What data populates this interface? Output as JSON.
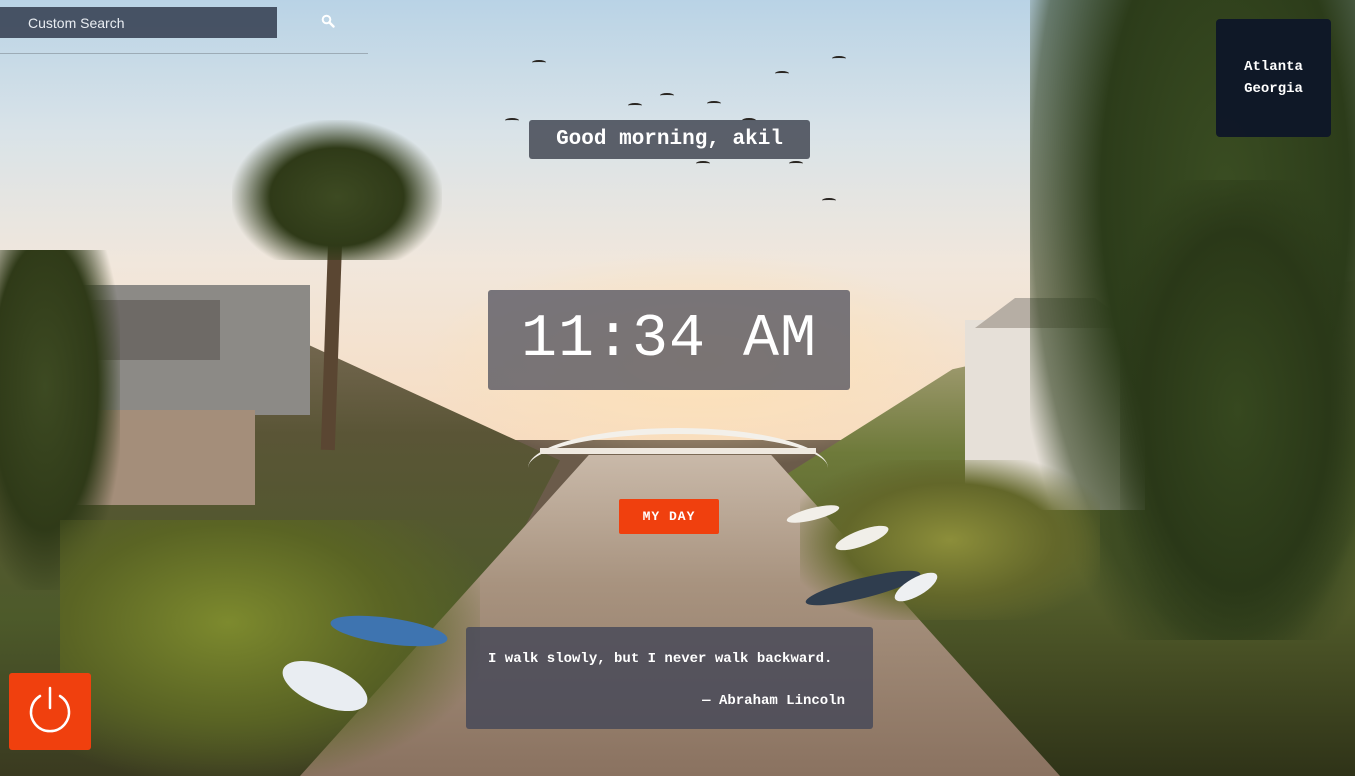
{
  "search": {
    "label": "Custom Search",
    "icon": "search-icon"
  },
  "location": {
    "city": "Atlanta",
    "region": "Georgia"
  },
  "greeting": {
    "text": "Good morning, akil"
  },
  "clock": {
    "time": "11:34 AM"
  },
  "my_day_button": {
    "label": "MY DAY",
    "color": "#f0400e"
  },
  "quote": {
    "text": "I walk slowly, but I never walk backward.",
    "author": "— Abraham Lincoln"
  },
  "power_button": {
    "icon": "power-icon",
    "color": "#f0400e"
  }
}
